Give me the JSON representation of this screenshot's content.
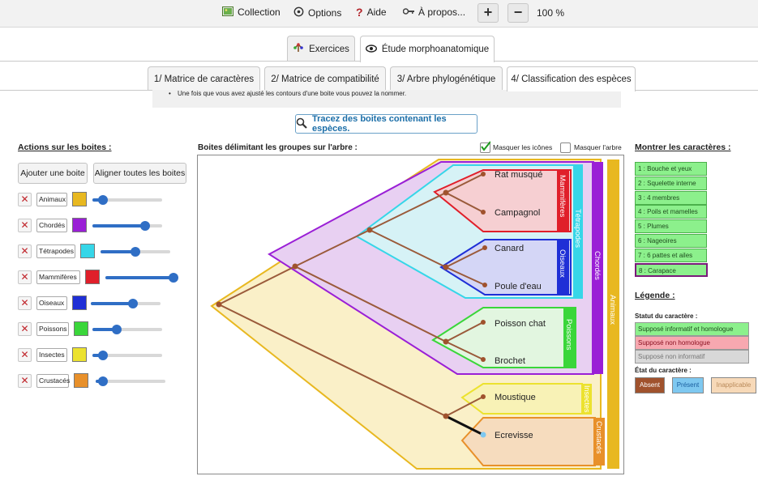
{
  "topbar": {
    "collection": "Collection",
    "options": "Options",
    "aide": "Aide",
    "apropos": "À propos...",
    "plus": "+",
    "minus": "−",
    "zoom": "100 %"
  },
  "main_tabs": [
    {
      "label": "Exercices",
      "active": false
    },
    {
      "label": "Étude morphoanatomique",
      "active": true
    }
  ],
  "sub_tabs": [
    {
      "label": "1/ Matrice de caractères",
      "active": false
    },
    {
      "label": "2/ Matrice de compatibilité",
      "active": false
    },
    {
      "label": "3/ Arbre phylogénétique",
      "active": false
    },
    {
      "label": "4/ Classification des espèces",
      "active": true
    }
  ],
  "hint": "Une fois que vous avez ajusté les contours d'une boite vous pouvez la nommer.",
  "trace_button": "Tracez des boites contenant les espèces.",
  "left_panel": {
    "title": "Actions sur les boites :",
    "add_button": "Ajouter une boite",
    "align_button": "Aligner toutes les boites",
    "boxes": [
      {
        "name": "Animaux",
        "color": "#e8b820",
        "level": 0.15
      },
      {
        "name": "Chordés",
        "color": "#9a1fd6",
        "level": 0.75
      },
      {
        "name": "Tétrapodes",
        "color": "#36d6e8",
        "level": 0.5
      },
      {
        "name": "Mammifères",
        "color": "#e01f2a",
        "level": 0.98
      },
      {
        "name": "Oiseaux",
        "color": "#1f2fd6",
        "level": 0.6
      },
      {
        "name": "Poissons",
        "color": "#3ad63a",
        "level": 0.35
      },
      {
        "name": "Insectes",
        "color": "#ece22f",
        "level": 0.15
      },
      {
        "name": "Crustacés",
        "color": "#e8902a",
        "level": 0.1
      }
    ]
  },
  "tree": {
    "title": "Boites délimitant les groupes sur l'arbre :",
    "hide_icons": {
      "label": "Masquer les icônes",
      "checked": true
    },
    "hide_tree": {
      "label": "Masquer l'arbre",
      "checked": false
    },
    "species": [
      "Rat musqué",
      "Campagnol",
      "Canard",
      "Poule d'eau",
      "Poisson chat",
      "Brochet",
      "Moustique",
      "Ecrevisse"
    ],
    "group_labels": [
      "Mammifères",
      "Tétrapodes",
      "Oiseaux",
      "Chordés",
      "Poissons",
      "Animaux",
      "Insectes",
      "Crustacés"
    ]
  },
  "right_panel": {
    "title": "Montrer les caractères :",
    "characters": [
      "1 : Bouche et yeux",
      "2 : Squelette interne",
      "3 : 4 membres",
      "4 : Poils et mamelles",
      "5 : Plumes",
      "6 : Nageoires",
      "7 : 6 pattes et ailes",
      "8 : Carapace"
    ],
    "selected_character": "8 : Carapace",
    "legend_title": "Légende :",
    "status_title": "Statut du caractère :",
    "status": [
      {
        "label": "Supposé informatif et homologue",
        "color": "#8cf08c"
      },
      {
        "label": "Supposé non homologue",
        "color": "#f7a8b0"
      },
      {
        "label": "Supposé non informatif",
        "color": "#d8d8d8"
      }
    ],
    "state_title": "État du caractère :",
    "states": [
      {
        "label": "Absent",
        "color": "#a0522d"
      },
      {
        "label": "Présent",
        "color": "#7ec8f0"
      },
      {
        "label": "Inapplicable",
        "color": "#f7d9b8"
      }
    ]
  }
}
